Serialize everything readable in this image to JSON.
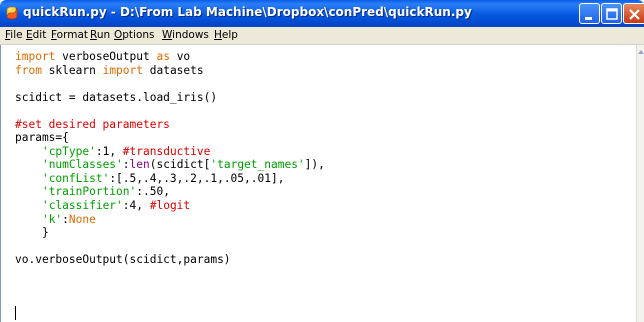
{
  "window": {
    "title": "quickRun.py - D:\\From Lab Machine\\Dropbox\\conPred\\quickRun.py",
    "controls": [
      "minimize",
      "maximize",
      "close"
    ]
  },
  "menu": {
    "items": [
      {
        "label": "File"
      },
      {
        "label": "Edit"
      },
      {
        "label": "Format"
      },
      {
        "label": "Run"
      },
      {
        "label": "Options"
      },
      {
        "label": "Windows"
      },
      {
        "label": "Help"
      }
    ]
  },
  "editor": {
    "language": "python",
    "lines": [
      [
        {
          "t": "import",
          "c": "kw"
        },
        {
          "t": " verboseOutput "
        },
        {
          "t": "as",
          "c": "kw"
        },
        {
          "t": " vo"
        }
      ],
      [
        {
          "t": "from",
          "c": "kw"
        },
        {
          "t": " sklearn "
        },
        {
          "t": "import",
          "c": "kw"
        },
        {
          "t": " datasets"
        }
      ],
      [],
      [
        {
          "t": "scidict = datasets.load_iris()"
        }
      ],
      [],
      [
        {
          "t": "#set desired parameters",
          "c": "cm"
        }
      ],
      [
        {
          "t": "params={"
        }
      ],
      [
        {
          "t": "    "
        },
        {
          "t": "'cpType'",
          "c": "st"
        },
        {
          "t": ":1, "
        },
        {
          "t": "#transductive",
          "c": "cm"
        }
      ],
      [
        {
          "t": "    "
        },
        {
          "t": "'numClasses'",
          "c": "st"
        },
        {
          "t": ":"
        },
        {
          "t": "len",
          "c": "bi"
        },
        {
          "t": "(scidict["
        },
        {
          "t": "'target_names'",
          "c": "st"
        },
        {
          "t": "]),"
        }
      ],
      [
        {
          "t": "    "
        },
        {
          "t": "'confList'",
          "c": "st"
        },
        {
          "t": ":[.5,.4,.3,.2,.1,.05,.01],"
        }
      ],
      [
        {
          "t": "    "
        },
        {
          "t": "'trainPortion'",
          "c": "st"
        },
        {
          "t": ":.50,"
        }
      ],
      [
        {
          "t": "    "
        },
        {
          "t": "'classifier'",
          "c": "st"
        },
        {
          "t": ":4, "
        },
        {
          "t": "#logit",
          "c": "cm"
        }
      ],
      [
        {
          "t": "    "
        },
        {
          "t": "'k'",
          "c": "st"
        },
        {
          "t": ":"
        },
        {
          "t": "None",
          "c": "kw"
        }
      ],
      [
        {
          "t": "    }"
        }
      ],
      [],
      [
        {
          "t": "vo.verboseOutput(scidict,params)"
        }
      ]
    ]
  },
  "colors": {
    "keyword": "#e26b00",
    "string": "#00a000",
    "comment": "#dd0000",
    "builtin": "#900090",
    "titlebar": "#0558e0",
    "menubar": "#ece9d8"
  }
}
